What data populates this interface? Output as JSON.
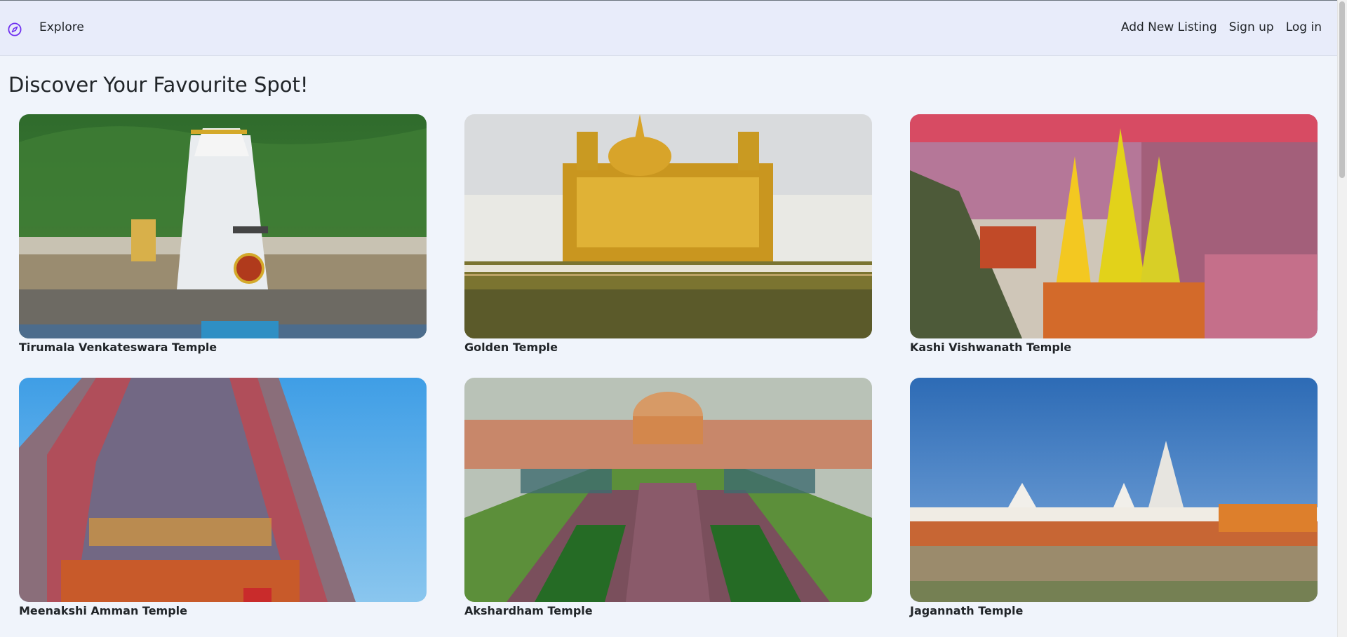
{
  "nav": {
    "brand_icon": "compass-icon",
    "explore_label": "Explore",
    "right_links": [
      "Add New Listing",
      "Sign up",
      "Log in"
    ]
  },
  "page": {
    "title": "Discover Your Favourite Spot!"
  },
  "listings": [
    {
      "title": "Tirumala Venkateswara Temple",
      "image": "tirumala-temple-image"
    },
    {
      "title": "Golden Temple",
      "image": "golden-temple-image"
    },
    {
      "title": "Kashi Vishwanath Temple",
      "image": "kashi-vishwanath-image"
    },
    {
      "title": "Meenakshi Amman Temple",
      "image": "meenakshi-amman-image"
    },
    {
      "title": "Akshardham Temple",
      "image": "akshardham-image"
    },
    {
      "title": "Jagannath Temple",
      "image": "jagannath-image"
    }
  ],
  "colors": {
    "accent": "#6f2ff0",
    "navbar_bg": "#e8ecfa",
    "page_bg": "#f0f4fb"
  }
}
